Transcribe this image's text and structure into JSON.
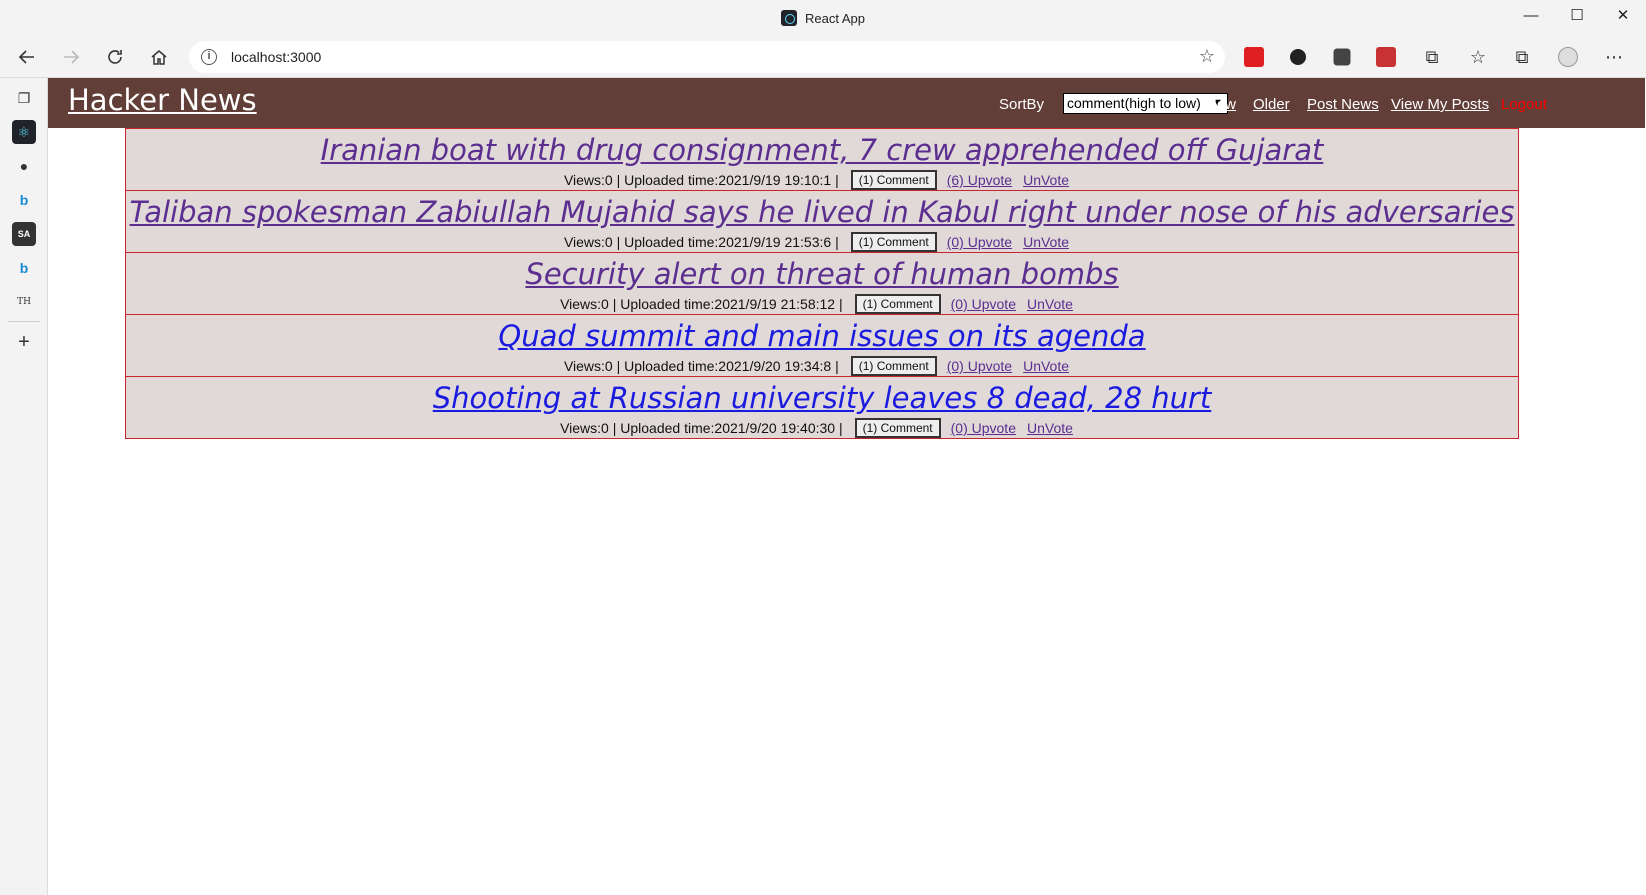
{
  "window": {
    "title": "React App",
    "controls": [
      "—",
      "☐",
      "✕"
    ]
  },
  "toolbar": {
    "url": "localhost:3000"
  },
  "header": {
    "brand": "Hacker News",
    "sort_label": "SortBy",
    "sort_selected": "comment(high to low)",
    "nav": {
      "new": "New",
      "older": "Older",
      "post_news": "Post News",
      "view_my_posts": "View My Posts",
      "logout": "Logout"
    }
  },
  "posts": [
    {
      "title": "Iranian boat with drug consignment, 7 crew apprehended off Gujarat",
      "meta": "Views:0 | Uploaded time:2021/9/19 19:10:1 |",
      "comment": "(1) Comment",
      "upvote": "(6) Upvote",
      "unvote": "UnVote"
    },
    {
      "title": "Taliban spokesman Zabiullah Mujahid says he lived in Kabul right under nose of his adversaries",
      "meta": "Views:0 | Uploaded time:2021/9/19 21:53:6 |",
      "comment": "(1) Comment",
      "upvote": "(0) Upvote",
      "unvote": "UnVote"
    },
    {
      "title": "Security alert on threat of human bombs",
      "meta": "Views:0 | Uploaded time:2021/9/19 21:58:12 |",
      "comment": "(1) Comment",
      "upvote": "(0) Upvote",
      "unvote": "UnVote"
    },
    {
      "title": "Quad summit and main issues on its agenda",
      "meta": "Views:0 | Uploaded time:2021/9/20 19:34:8 |",
      "comment": "(1) Comment",
      "upvote": "(0) Upvote",
      "unvote": "UnVote"
    },
    {
      "title": "Shooting at Russian university leaves 8 dead, 28 hurt",
      "meta": "Views:0 | Uploaded time:2021/9/20 19:40:30 |",
      "comment": "(1) Comment",
      "upvote": "(0) Upvote",
      "unvote": "UnVote"
    }
  ],
  "sidebar": {
    "items": [
      "tab-actions-icon",
      "react-icon",
      "github-icon",
      "bing-icon",
      "sa-icon",
      "bing-icon",
      "th-icon",
      "add-icon"
    ],
    "sa_text": "SA",
    "th_text": "TH"
  },
  "colors": {
    "header_bg": "#613e37",
    "post_bg": "#e0d9d8",
    "post_border": "#c6262c",
    "visited_link": "#5b2e8f",
    "link": "#1b1bdf",
    "logout": "#ff0000"
  }
}
